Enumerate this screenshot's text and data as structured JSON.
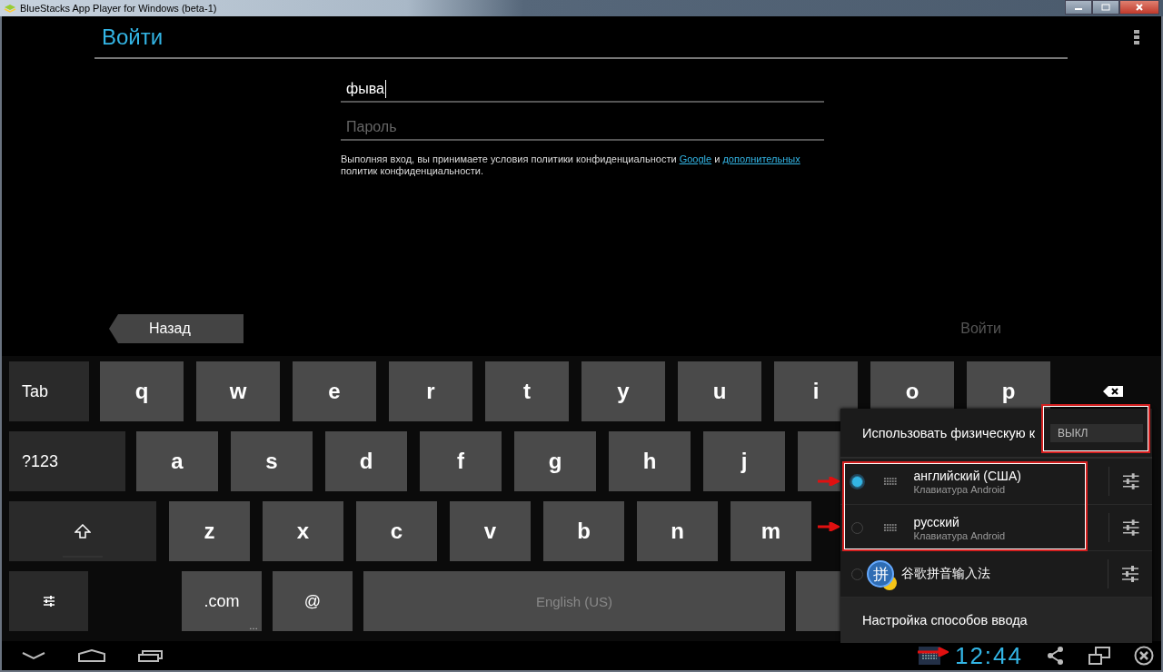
{
  "window": {
    "title": "BlueStacks App Player for Windows (beta-1)"
  },
  "action_bar": {
    "title": "Войти"
  },
  "form": {
    "username": {
      "value": "фыва"
    },
    "password": {
      "placeholder": "Пароль"
    },
    "terms": {
      "before": "Выполняя вход, вы принимаете условия политики конфиденциальности ",
      "link1": "Google",
      "middle": " и ",
      "link2": "дополнительных",
      "after": " политик конфиденциальности."
    }
  },
  "nav_buttons": {
    "back": {
      "label": "Назад"
    },
    "next": {
      "label": "Войти",
      "disabled": true
    }
  },
  "keyboard": {
    "rows": [
      {
        "keys": [
          {
            "kind": "function",
            "label": "Tab"
          },
          {
            "kind": "letter",
            "label": "q"
          },
          {
            "kind": "letter",
            "label": "w"
          },
          {
            "kind": "letter",
            "label": "e"
          },
          {
            "kind": "letter",
            "label": "r"
          },
          {
            "kind": "letter",
            "label": "t"
          },
          {
            "kind": "letter",
            "label": "y"
          },
          {
            "kind": "letter",
            "label": "u"
          },
          {
            "kind": "letter",
            "label": "i"
          },
          {
            "kind": "letter",
            "label": "o"
          },
          {
            "kind": "letter",
            "label": "p"
          },
          {
            "kind": "backspace"
          }
        ]
      },
      {
        "keys": [
          {
            "kind": "function",
            "label": "?123"
          },
          {
            "kind": "letter",
            "label": "a"
          },
          {
            "kind": "letter",
            "label": "s"
          },
          {
            "kind": "letter",
            "label": "d"
          },
          {
            "kind": "letter",
            "label": "f"
          },
          {
            "kind": "letter",
            "label": "g"
          },
          {
            "kind": "letter",
            "label": "h"
          },
          {
            "kind": "letter",
            "label": "j"
          },
          {
            "kind": "blank"
          }
        ]
      },
      {
        "keys": [
          {
            "kind": "shift"
          },
          {
            "kind": "letter",
            "label": "z"
          },
          {
            "kind": "letter",
            "label": "x"
          },
          {
            "kind": "letter",
            "label": "c"
          },
          {
            "kind": "letter",
            "label": "v"
          },
          {
            "kind": "letter",
            "label": "b"
          },
          {
            "kind": "letter",
            "label": "n"
          },
          {
            "kind": "letter",
            "label": "m"
          }
        ]
      },
      {
        "keys": [
          {
            "kind": "settings"
          },
          {
            "kind": "letter",
            "label": ".com",
            "hint": "…"
          },
          {
            "kind": "letter",
            "label": "@"
          },
          {
            "kind": "space",
            "label": "English (US)"
          },
          {
            "kind": "blank"
          }
        ]
      }
    ]
  },
  "ime_popup": {
    "physical": {
      "label": "Использовать физическую к",
      "toggle": {
        "label": "ВЫКЛ",
        "on": false
      }
    },
    "methods": [
      {
        "kind": "keyboard",
        "name": "английский (США)",
        "subtitle": "Клавиатура Android",
        "selected": true
      },
      {
        "kind": "keyboard",
        "name": "русский",
        "subtitle": "Клавиатура Android",
        "selected": false
      },
      {
        "kind": "app",
        "logo": "拼",
        "name": "谷歌拼音输入法",
        "selected": false
      }
    ],
    "settings_label": "Настройка способов ввода"
  },
  "status_bar": {
    "time": "12:44"
  }
}
